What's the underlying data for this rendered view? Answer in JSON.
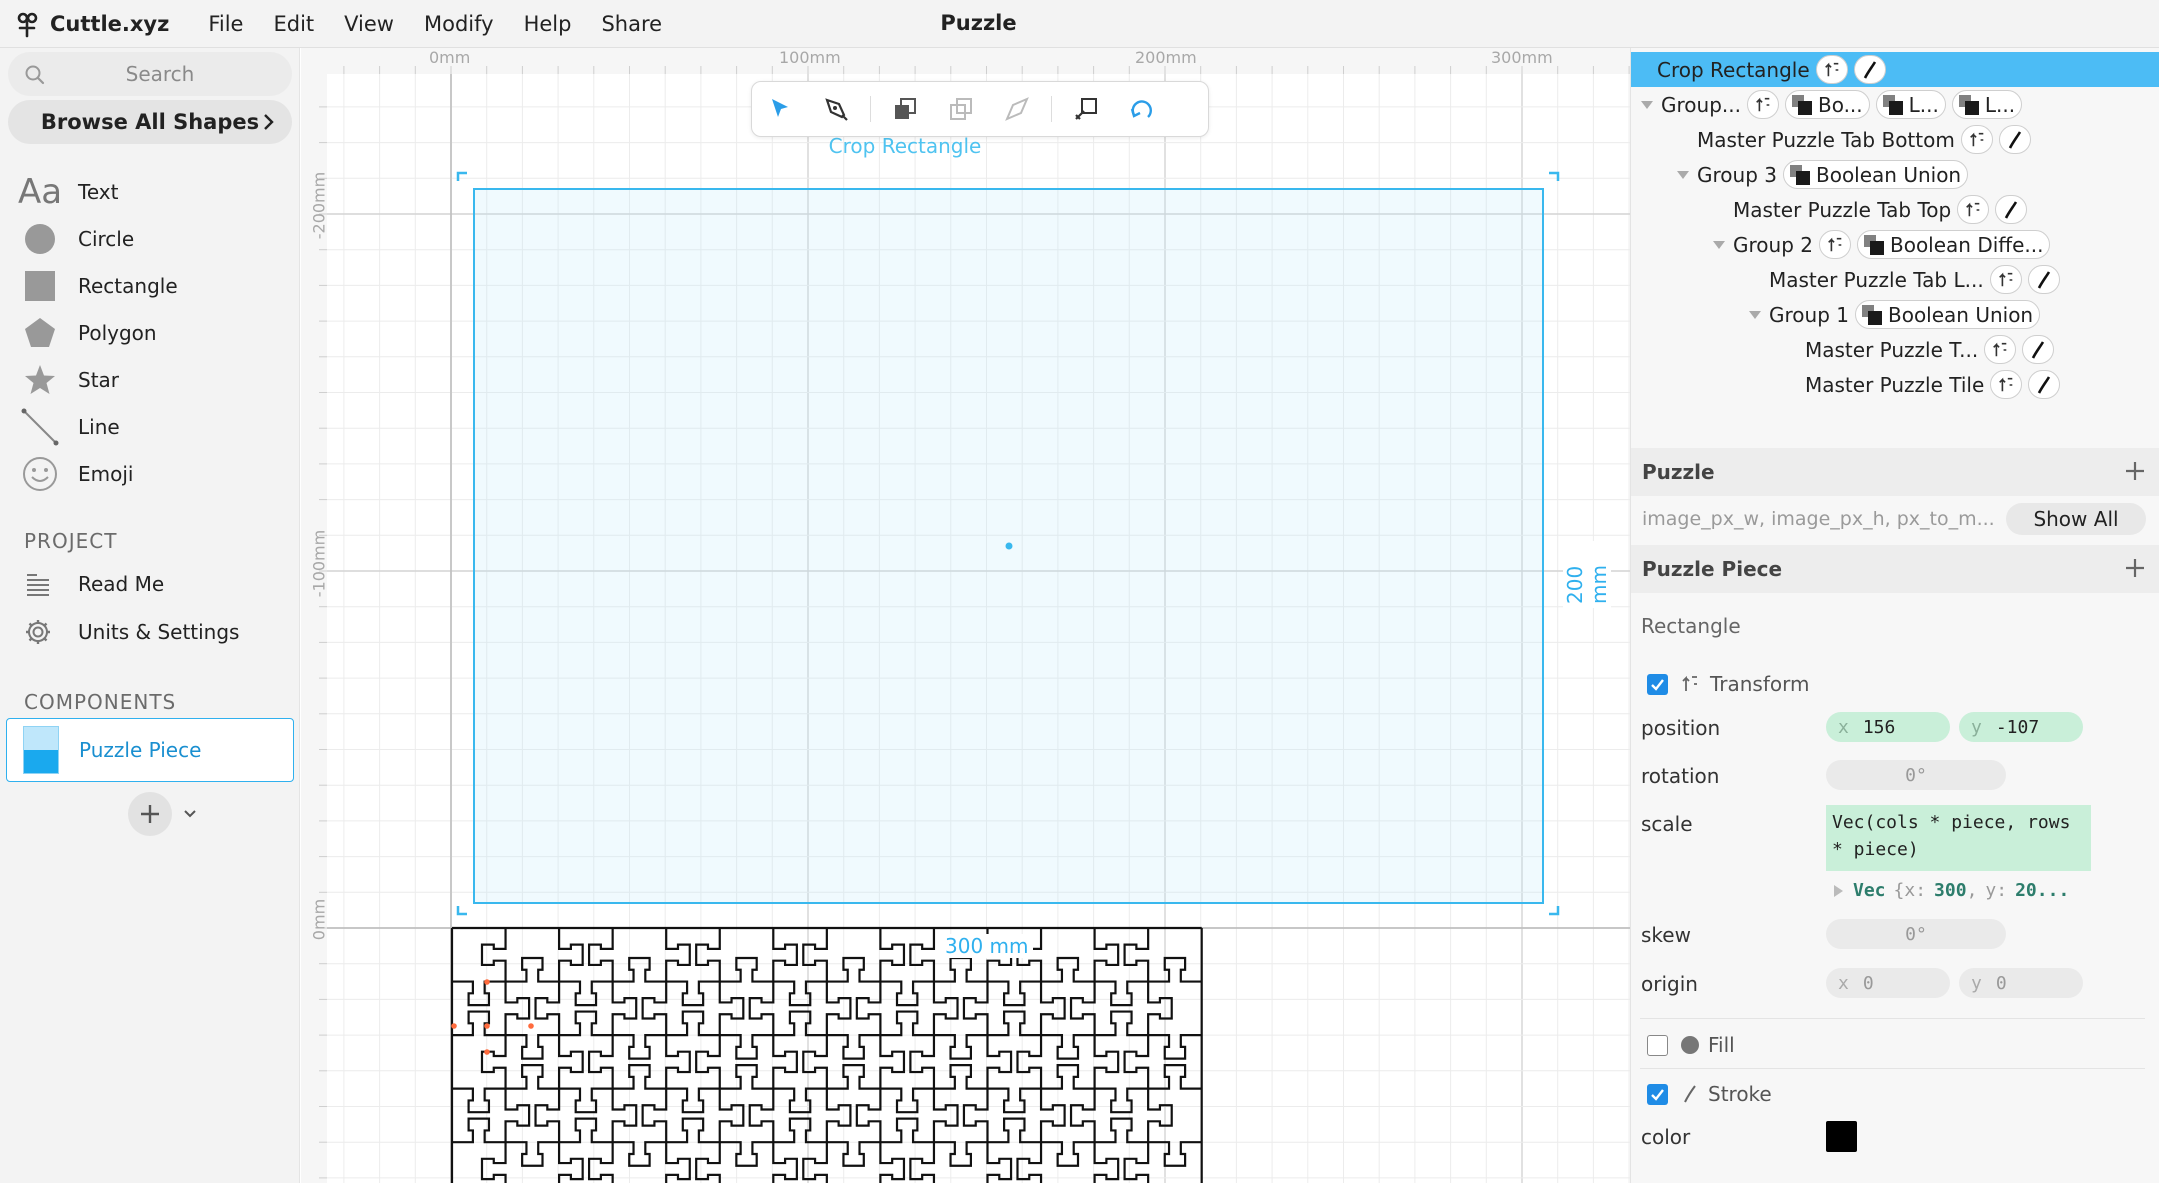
{
  "app": {
    "name": "Cuttle.xyz",
    "document_title": "Puzzle"
  },
  "menu": [
    "File",
    "Edit",
    "View",
    "Modify",
    "Help",
    "Share"
  ],
  "left": {
    "search_placeholder": "Search",
    "browse_label": "Browse All Shapes",
    "shapes": [
      {
        "label": "Text",
        "icon": "text-icon"
      },
      {
        "label": "Circle",
        "icon": "circle-icon"
      },
      {
        "label": "Rectangle",
        "icon": "rectangle-icon"
      },
      {
        "label": "Polygon",
        "icon": "polygon-icon"
      },
      {
        "label": "Star",
        "icon": "star-icon"
      },
      {
        "label": "Line",
        "icon": "line-icon"
      },
      {
        "label": "Emoji",
        "icon": "emoji-icon"
      }
    ],
    "project_heading": "PROJECT",
    "project_items": [
      {
        "label": "Read Me",
        "icon": "readme-icon"
      },
      {
        "label": "Units & Settings",
        "icon": "gear-icon"
      }
    ],
    "components_heading": "COMPONENTS",
    "components": [
      {
        "label": "Puzzle Piece"
      }
    ]
  },
  "canvas": {
    "ruler_top": [
      "0mm",
      "100mm",
      "200mm",
      "300mm"
    ],
    "ruler_left": [
      "-200mm",
      "-100mm",
      "0mm"
    ],
    "selection_label": "Crop Rectangle",
    "dim_width": "300 mm",
    "dim_height": "200 mm",
    "tools": [
      "select-tool",
      "pen-tool",
      "bring-forward-tool",
      "duplicate-tool",
      "send-backward-tool",
      "boolean-tool",
      "rotate-tool"
    ]
  },
  "outline": {
    "rows": [
      {
        "name": "Crop Rectangle",
        "pills": [
          "transform",
          "stroke"
        ],
        "selected": true
      },
      {
        "name": "Group...",
        "pills": [
          "transform",
          "Bo...",
          "L...",
          "L..."
        ],
        "expandable": true
      },
      {
        "name": "Master Puzzle Tab Bottom",
        "pills": [
          "transform",
          "stroke"
        ]
      },
      {
        "name": "Group 3",
        "pills": [
          "Boolean Union"
        ],
        "expandable": true
      },
      {
        "name": "Master Puzzle Tab Top",
        "pills": [
          "transform",
          "stroke"
        ]
      },
      {
        "name": "Group 2",
        "pills": [
          "transform",
          "Boolean Diffe..."
        ],
        "expandable": true
      },
      {
        "name": "Master Puzzle Tab L...",
        "pills": [
          "transform",
          "stroke"
        ]
      },
      {
        "name": "Group 1",
        "pills": [
          "Boolean Union"
        ],
        "expandable": true
      },
      {
        "name": "Master Puzzle T...",
        "pills": [
          "transform",
          "stroke"
        ]
      },
      {
        "name": "Master Puzzle Tile",
        "pills": [
          "transform",
          "stroke"
        ]
      }
    ]
  },
  "params": {
    "puzzle_header": "Puzzle",
    "puzzle_params": "image_px_w, image_px_h, px_to_m...",
    "show_all": "Show All",
    "piece_header": "Puzzle Piece"
  },
  "inspector": {
    "title": "Rectangle",
    "transform_label": "Transform",
    "transform_checked": true,
    "position_label": "position",
    "position": {
      "x_axis": "x",
      "x": "156",
      "y_axis": "y",
      "y": "-107"
    },
    "rotation_label": "rotation",
    "rotation": "0°",
    "scale_label": "scale",
    "scale_expr": "Vec(cols * piece, rows * piece)",
    "scale_vec": {
      "type": "Vec",
      "open": "{",
      "x_key": "x:",
      "x": "300",
      "sep": ",",
      "y_key": "y:",
      "y": "20..."
    },
    "skew_label": "skew",
    "skew": "0°",
    "origin_label": "origin",
    "origin": {
      "x_axis": "x",
      "x": "0",
      "y_axis": "y",
      "y": "0"
    },
    "fill_label": "Fill",
    "fill_checked": false,
    "stroke_label": "Stroke",
    "stroke_checked": true,
    "color_label": "color",
    "stroke_color": "#000000"
  },
  "colors": {
    "accent": "#4cbcf5",
    "selection": "#39b8ee",
    "expr_bg": "#c9efd9"
  }
}
